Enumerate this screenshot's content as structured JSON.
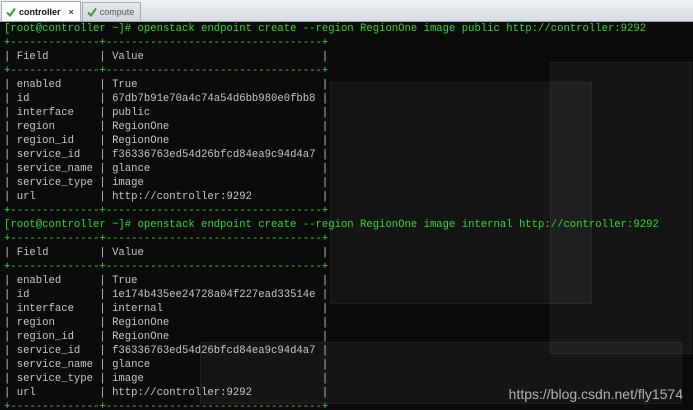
{
  "tabs": [
    {
      "label": "controller",
      "active": true,
      "close": "×"
    },
    {
      "label": "compute",
      "active": false
    }
  ],
  "blocks": [
    {
      "prompt": "[root@controller ~]#",
      "command": " openstack endpoint create --region RegionOne image public http://controller:9292",
      "border": "+--------------+----------------------------------+",
      "header": "| Field        | Value                            |",
      "rows": [
        "| enabled      | True                             |",
        "| id           | 67db7b91e70a4c74a54d6bb980e0fbb8 |",
        "| interface    | public                           |",
        "| region       | RegionOne                        |",
        "| region_id    | RegionOne                        |",
        "| service_id   | f36336763ed54d26bfcd84ea9c94d4a7 |",
        "| service_name | glance                           |",
        "| service_type | image                            |",
        "| url          | http://controller:9292           |"
      ]
    },
    {
      "prompt": "[root@controller ~]#",
      "command": " openstack endpoint create --region RegionOne image internal http://controller:9292",
      "border": "+--------------+----------------------------------+",
      "header": "| Field        | Value                            |",
      "rows": [
        "| enabled      | True                             |",
        "| id           | 1e174b435ee24728a04f227ead33514e |",
        "| interface    | internal                         |",
        "| region       | RegionOne                        |",
        "| region_id    | RegionOne                        |",
        "| service_id   | f36336763ed54d26bfcd84ea9c94d4a7 |",
        "| service_name | glance                           |",
        "| service_type | image                            |",
        "| url          | http://controller:9292           |"
      ]
    }
  ],
  "watermark": "https://blog.csdn.net/fly1574",
  "colors": {
    "terminal_bg": "#0b0b0b",
    "prompt_green": "#2fdc2f",
    "text": "#c6c6c6"
  },
  "icons": {
    "tab_status": "green-check-icon"
  }
}
